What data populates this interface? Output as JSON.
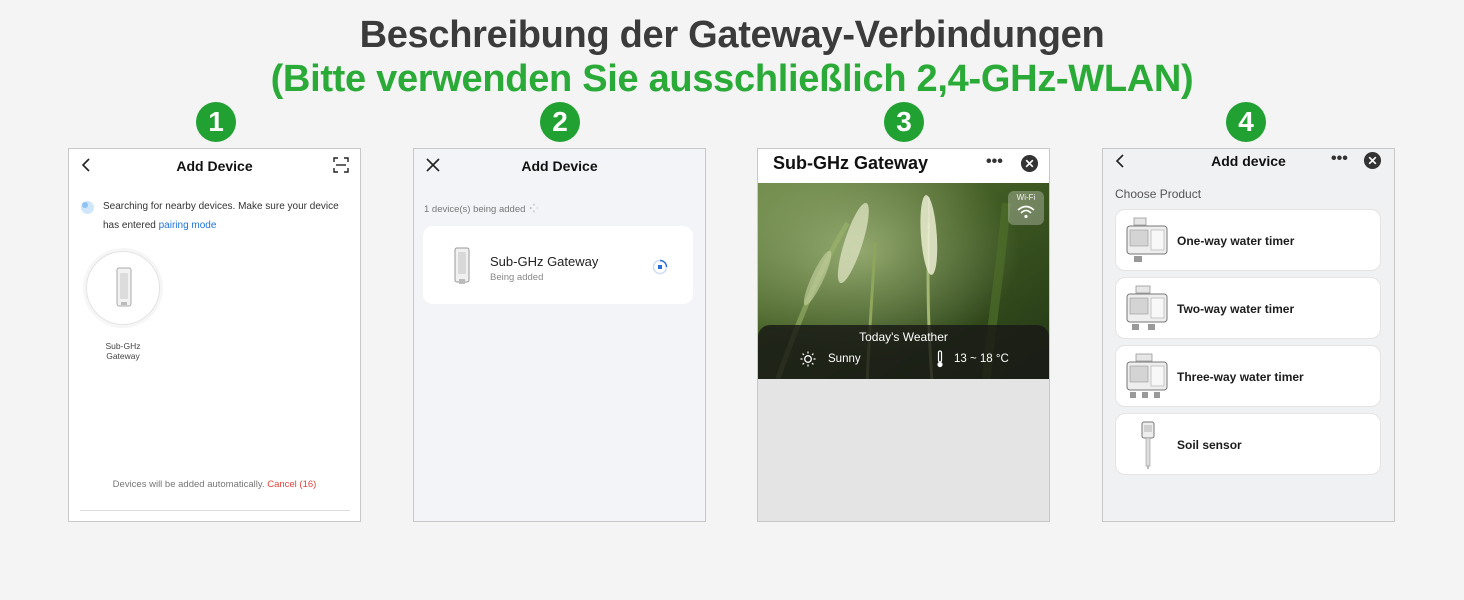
{
  "heading": {
    "line1": "Beschreibung der Gateway-Verbindungen",
    "line2": "(Bitte verwenden Sie ausschließlich 2,4-GHz-WLAN)"
  },
  "steps": [
    "1",
    "2",
    "3",
    "4"
  ],
  "colors": {
    "accent_green": "#2aaa37",
    "badge_green": "#20a132",
    "link_blue": "#1e74d9",
    "cancel_red": "#e0443c"
  },
  "panel1": {
    "title": "Add Device",
    "search_text": "Searching for nearby devices. Make sure your device has entered ",
    "pairing_link": "pairing mode",
    "device_label_line1": "Sub-GHz",
    "device_label_line2": "Gateway",
    "footer_text": "Devices will be added automatically.",
    "cancel_label": "Cancel (16)",
    "icons": {
      "back": "chevron-left-icon",
      "scan": "scan-icon"
    }
  },
  "panel2": {
    "title": "Add Device",
    "status": "1 device(s) being added",
    "device_name": "Sub-GHz Gateway",
    "device_status": "Being added",
    "icons": {
      "close": "close-icon",
      "spinner": "loading-spinner-icon"
    }
  },
  "panel3": {
    "title": "Sub-GHz Gateway",
    "more": "•••",
    "wifi_label": "Wi-Fi",
    "weather_title": "Today's Weather",
    "condition": "Sunny",
    "temperature": "13 ~ 18 °C",
    "icons": {
      "close": "circle-close-icon",
      "wifi": "wifi-icon",
      "sun": "sun-icon",
      "thermometer": "thermometer-icon"
    }
  },
  "panel4": {
    "title": "Add device",
    "more": "•••",
    "choose_label": "Choose Product",
    "products": [
      "One-way water timer",
      "Two-way water timer",
      "Three-way water timer",
      "Soil sensor"
    ],
    "icons": {
      "back": "chevron-left-icon",
      "close": "circle-close-icon"
    }
  }
}
